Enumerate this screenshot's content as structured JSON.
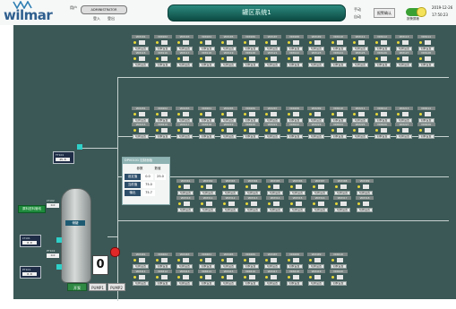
{
  "app": {
    "logo_text": "wilmar",
    "title": "罐区系统1",
    "user_label": "用户",
    "user_value": "ADMINISTRATOR",
    "login_label": "登入",
    "logout_label": "登出",
    "mode_top": "手动",
    "mode_bottom": "自动",
    "button_label": "报警确认",
    "toggle_label": "报警屏蔽",
    "date": "2019-12-26",
    "time": "17:50:23"
  },
  "colors": {
    "background": "#3b5856",
    "pipe": "#c7d2d0",
    "title_bar": "#1b6b62",
    "valve_on": "#e8d838"
  },
  "icons": {
    "valve": "valve-icon",
    "pump": "pump-icon",
    "tank": "tank-icon"
  },
  "panel": {
    "title": "DPV0101 控制面板",
    "headers": [
      "参数",
      "数值"
    ],
    "rows": [
      {
        "label": "设定值",
        "value": "0.0",
        "value2": "25.0"
      },
      {
        "label": "当前值",
        "value": "75.0",
        "value2": ""
      },
      {
        "label": "输出",
        "value": "75.7",
        "value2": ""
      }
    ]
  },
  "tank": {
    "label": "储罐",
    "level_display": "0",
    "buttons": [
      "开泵",
      "PUMP1",
      "PUMP2"
    ]
  },
  "left": {
    "feed_label": "原料进料管线",
    "readouts": [
      {
        "title": "TT101",
        "value": "25.8"
      },
      {
        "title": "LT101",
        "value": "0.0"
      },
      {
        "title": "PT101",
        "value": "0.0"
      }
    ],
    "small_label_1": "LT102",
    "small_label_2": "PT102",
    "small_value_1": "0.0",
    "small_value_2": "0.0"
  },
  "grid": {
    "button_label": "切换设置",
    "row1a": [
      "VD0101",
      "VD0102",
      "VD0103",
      "VD0104",
      "VD0105",
      "VD0106",
      "VD0107",
      "VD0108",
      "VD0109",
      "VD0110",
      "VD0111",
      "VD0112",
      "VD0113",
      "VD0114"
    ],
    "row1b": [
      "VD0115",
      "VD0116",
      "VD0117",
      "VD0118",
      "VD0119",
      "VD0120",
      "VD0121",
      "VD0122",
      "VD0123",
      "VD0124",
      "VD0125",
      "VD0126",
      "VD0127",
      "VD0128"
    ],
    "row2a": [
      "VD0201",
      "VD0202",
      "VD0203",
      "VD0204",
      "VD0205",
      "VD0206",
      "VD0207",
      "VD0208",
      "VD0209",
      "VD0210",
      "VD0211",
      "VD0212",
      "VD0213",
      "VD0214"
    ],
    "row2b": [
      "VD0215",
      "VD0216",
      "VD0217",
      "VD0218",
      "VD0219",
      "VD0220",
      "VD0221",
      "VD0222",
      "VD0223",
      "VD0224",
      "VD0225",
      "VD0226",
      "VD0227",
      "VD0228"
    ],
    "row3a": [
      "VD0301",
      "VD0302",
      "VD0303",
      "VD0304",
      "VD0305",
      "VD0306",
      "VD0307",
      "VD0308",
      "VD0309"
    ],
    "row3b": [
      "VD0310",
      "VD0311",
      "VD0312",
      "VD0313",
      "VD0314",
      "VD0315",
      "VD0316",
      "VD0317",
      "VD0318"
    ],
    "row4a": [
      "VD0401",
      "VD0402",
      "VD0403",
      "VD0404",
      "VD0405",
      "VD0406",
      "VD0407",
      "VD0408",
      "VD0409",
      "VD0410"
    ],
    "row4b": [
      "VD0411",
      "VD0412",
      "VD0413",
      "VD0414",
      "VD0415",
      "VD0416",
      "VD0417",
      "VD0418",
      "VD0419",
      "VD0420"
    ]
  }
}
